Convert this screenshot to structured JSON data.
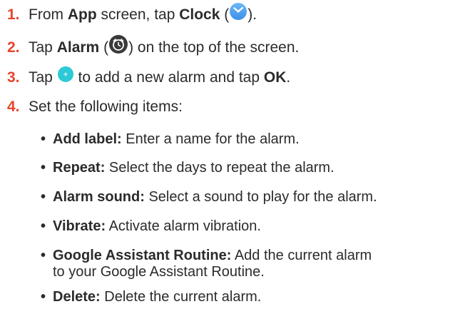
{
  "steps": [
    {
      "num": "1.",
      "parts": [
        "From ",
        "App",
        " screen, tap ",
        "Clock",
        " (",
        ")."
      ],
      "icon": "clock-app-icon"
    },
    {
      "num": "2.",
      "parts": [
        "Tap ",
        "Alarm",
        " (",
        ") on the top of the screen."
      ],
      "icon": "alarm-tab-icon"
    },
    {
      "num": "3.",
      "parts": [
        "Tap ",
        " to add a new alarm and tap ",
        "OK",
        "."
      ],
      "icon": "add-alarm-button-icon"
    },
    {
      "num": "4.",
      "parts": [
        "Set the following items:"
      ]
    }
  ],
  "items": [
    {
      "term": "Add label:",
      "desc": " Enter a name for the alarm."
    },
    {
      "term": "Repeat:",
      "desc": " Select the days to repeat the alarm."
    },
    {
      "term": "Alarm sound:",
      "desc": " Select a sound to play for the alarm."
    },
    {
      "term": "Vibrate:",
      "desc": " Activate alarm vibration."
    },
    {
      "term": "Google Assistant Routine:",
      "desc": " Add the current alarm",
      "desc2": "to your Google Assistant Routine."
    },
    {
      "term": "Delete:",
      "desc": " Delete the current alarm."
    }
  ],
  "bullet_char": "•",
  "colors": {
    "step_number": "#e8442a",
    "text": "#2b2b2b",
    "clock_icon_blue": "#4fa3f2",
    "add_button_teal": "#2ec9d6",
    "alarm_icon_dark": "#3a3a3a"
  }
}
